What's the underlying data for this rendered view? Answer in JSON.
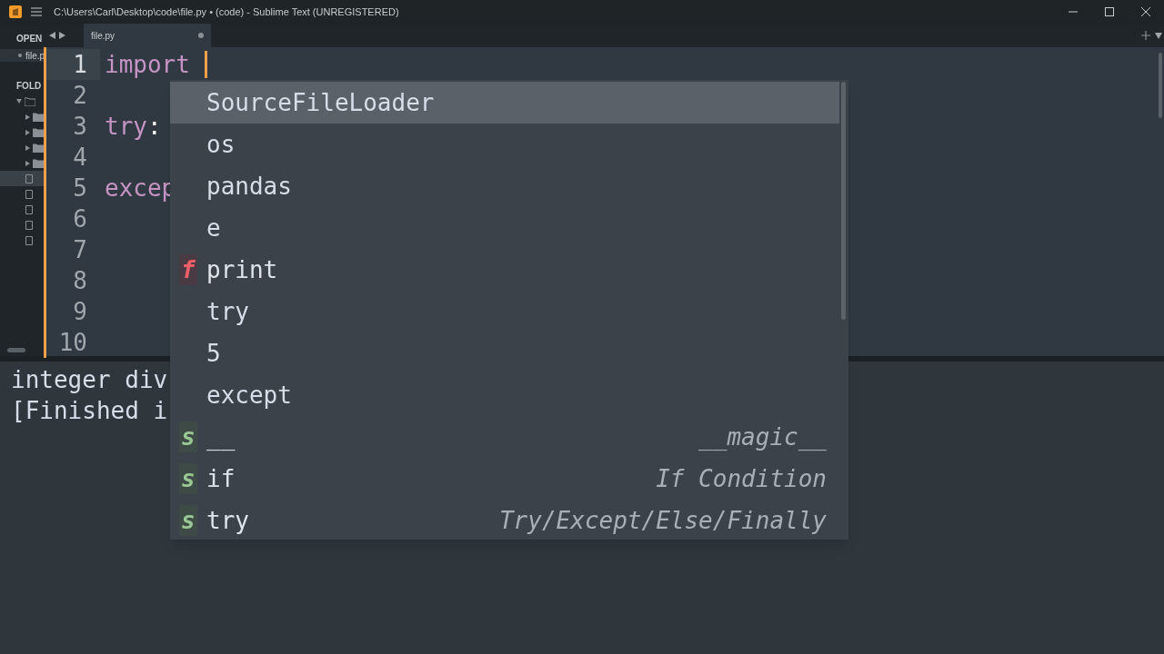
{
  "window": {
    "title": "C:\\Users\\Carl\\Desktop\\code\\file.py • (code) - Sublime Text (UNREGISTERED)"
  },
  "sidebar": {
    "open_label": "OPEN",
    "open_files": [
      {
        "name": "file.p"
      }
    ],
    "folders_label": "FOLD",
    "tree": [
      {
        "kind": "folder",
        "expanded": true,
        "selected": false,
        "children": [
          {
            "kind": "folder",
            "expanded": false,
            "selected": false
          },
          {
            "kind": "folder",
            "expanded": false,
            "selected": false
          },
          {
            "kind": "folder",
            "expanded": false,
            "selected": false
          },
          {
            "kind": "folder",
            "expanded": false,
            "selected": false
          },
          {
            "kind": "file",
            "selected": true
          },
          {
            "kind": "file",
            "selected": false
          },
          {
            "kind": "file",
            "selected": false
          },
          {
            "kind": "file",
            "selected": false
          },
          {
            "kind": "file",
            "selected": false
          }
        ]
      }
    ]
  },
  "tabs": [
    {
      "label": "file.py",
      "selected": true,
      "dirty": true
    }
  ],
  "editor": {
    "lines": [
      {
        "number": "1",
        "current": true,
        "tokens": [
          {
            "text": "import",
            "kind": "keyword"
          }
        ]
      },
      {
        "number": "2",
        "current": false
      },
      {
        "number": "3",
        "current": false,
        "tokens": [
          {
            "text": "try",
            "kind": "keyword"
          },
          {
            "text": ":",
            "kind": "punctuation"
          }
        ]
      },
      {
        "number": "4",
        "current": false
      },
      {
        "number": "5",
        "current": false,
        "tokens": [
          {
            "text": "excep",
            "kind": "keyword"
          }
        ]
      },
      {
        "number": "6",
        "current": false
      },
      {
        "number": "7",
        "current": false
      },
      {
        "number": "8",
        "current": false
      },
      {
        "number": "9",
        "current": false
      },
      {
        "number": "10",
        "current": false
      }
    ]
  },
  "output": {
    "lines": [
      "integer div",
      "[Finished i"
    ]
  },
  "completions": {
    "items": [
      {
        "text": "SourceFileLoader",
        "selected": true,
        "kind": "plain"
      },
      {
        "text": "os",
        "selected": false,
        "kind": "plain"
      },
      {
        "text": "pandas",
        "selected": false,
        "kind": "plain"
      },
      {
        "text": "e",
        "selected": false,
        "kind": "plain"
      },
      {
        "text": "print",
        "selected": false,
        "kind": "function",
        "kind_letter": "f"
      },
      {
        "text": "try",
        "selected": false,
        "kind": "plain"
      },
      {
        "text": "5",
        "selected": false,
        "kind": "plain"
      },
      {
        "text": "except",
        "selected": false,
        "kind": "plain"
      },
      {
        "text": "__",
        "selected": false,
        "kind": "snippet",
        "kind_letter": "s",
        "annotation": "__magic__"
      },
      {
        "text": "if",
        "selected": false,
        "kind": "snippet",
        "kind_letter": "s",
        "annotation": "If Condition"
      },
      {
        "text": "try",
        "selected": false,
        "kind": "snippet",
        "kind_letter": "s",
        "annotation": "Try/Except/Else/Finally"
      }
    ]
  }
}
